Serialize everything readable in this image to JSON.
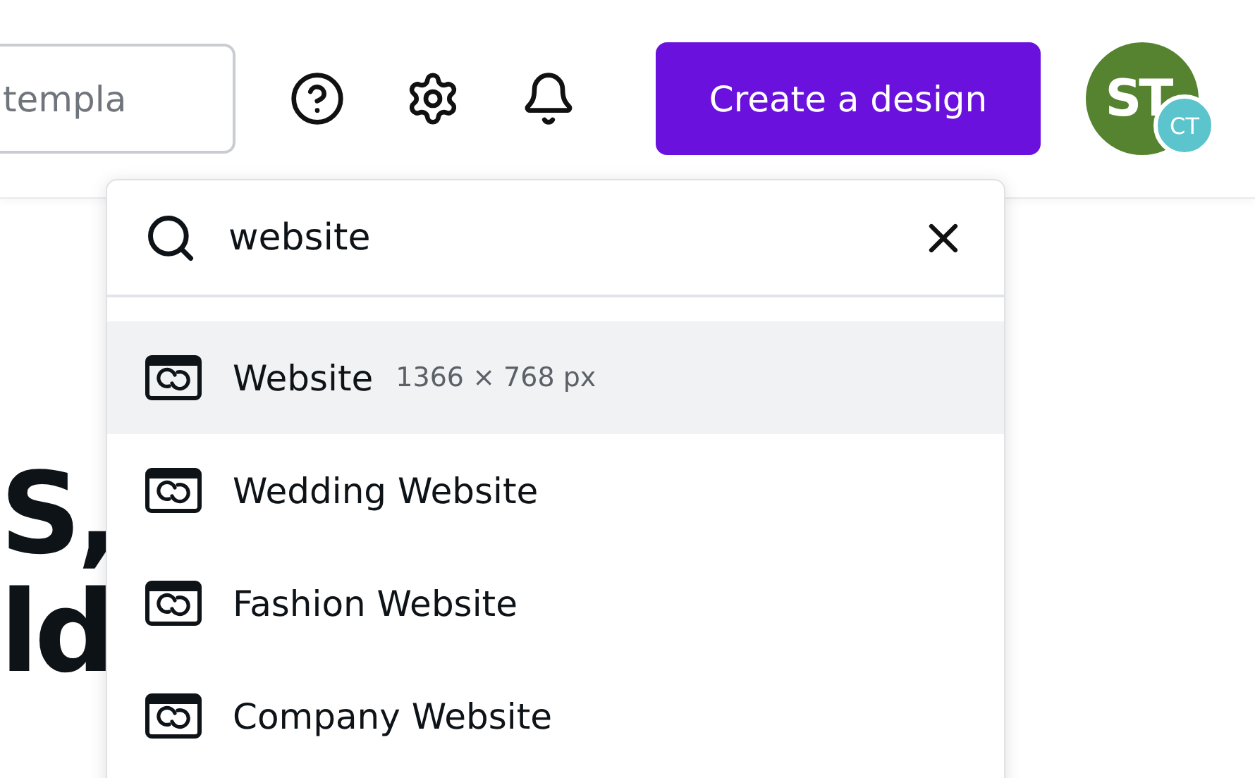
{
  "header": {
    "search": {
      "placeholder": "templa"
    },
    "create_button": "Create a design",
    "avatar": {
      "initials": "ST",
      "badge": "CT"
    }
  },
  "headline": [
    "S,",
    "ld"
  ],
  "dropdown": {
    "query": "website",
    "results": [
      {
        "label": "Website",
        "size": "1366 × 768 px",
        "selected": true
      },
      {
        "label": "Wedding Website",
        "selected": false
      },
      {
        "label": "Fashion Website",
        "selected": false
      },
      {
        "label": "Company Website",
        "selected": false
      }
    ]
  }
}
